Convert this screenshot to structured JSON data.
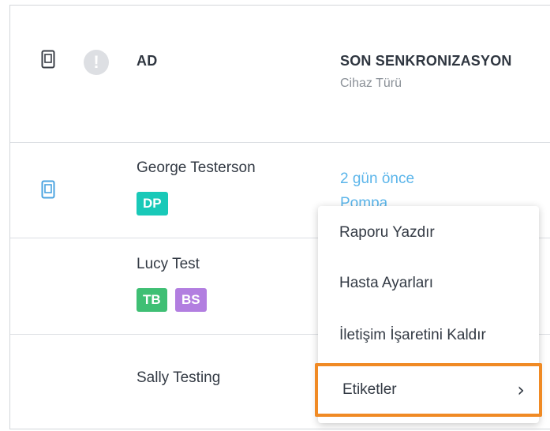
{
  "table": {
    "headers": {
      "name": "AD",
      "last_sync": "SON SENKRONIZASYON",
      "device_type": "Cihaz Türü"
    },
    "rows": [
      {
        "name": "George Testerson",
        "tags": [
          {
            "label": "DP",
            "color": "#19c9b8"
          }
        ],
        "last_sync": "2 gün önce",
        "device": "Pompa"
      },
      {
        "name": "Lucy Test",
        "tags": [
          {
            "label": "TB",
            "color": "#3fbf74"
          },
          {
            "label": "BS",
            "color": "#b27ee0"
          }
        ]
      },
      {
        "name": "Sally Testing",
        "tags": []
      }
    ]
  },
  "context_menu": {
    "items": [
      {
        "label": "Raporu Yazdır"
      },
      {
        "label": "Hasta Ayarları"
      },
      {
        "label": "İletişim İşaretini Kaldır"
      },
      {
        "label": "Etiketler",
        "has_submenu": true
      }
    ],
    "highlight_color": "#f08a24"
  },
  "colors": {
    "link": "#5bb5ea",
    "icon_active": "#4aa3e0"
  }
}
